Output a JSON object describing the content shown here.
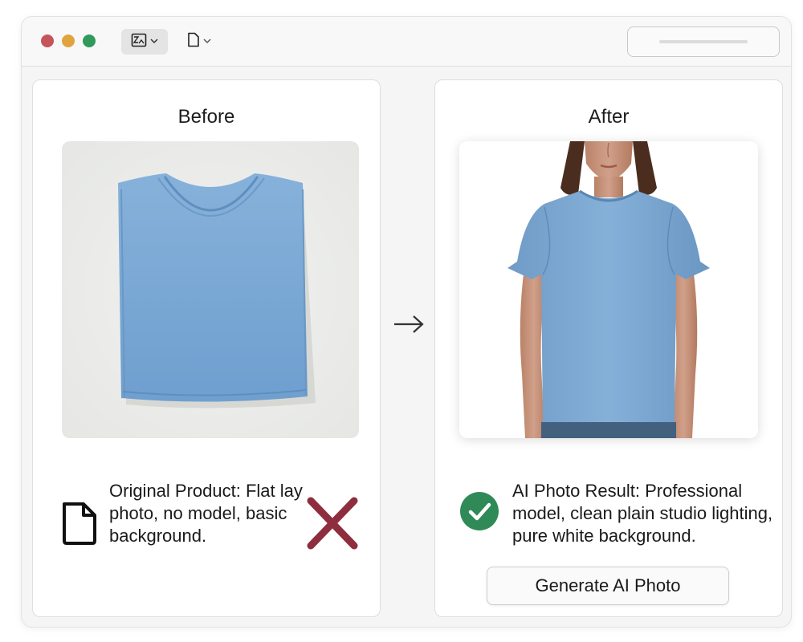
{
  "toolbar": {
    "image_menu_icon": "image-icon",
    "doc_menu_icon": "document-icon"
  },
  "before": {
    "title": "Before",
    "description": "Original Product: Flat lay photo, no model, basic background.",
    "status_icon": "cross-icon"
  },
  "after": {
    "title": "After",
    "description": "AI Photo Result: Professional model, clean plain studio lighting, pure white background.",
    "status_icon": "check-icon",
    "generate_label": "Generate AI Photo"
  },
  "colors": {
    "shirt": "#7aa7d3",
    "check": "#2f8a57",
    "cross": "#8e2d3e"
  }
}
